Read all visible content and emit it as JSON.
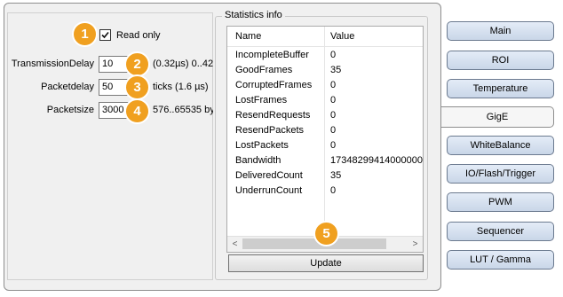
{
  "left": {
    "read_only_label": "Read only",
    "read_only_checked": true,
    "fields": [
      {
        "label": "TransmissionDelay",
        "value": "10",
        "info": "(0.32µs) 0..42"
      },
      {
        "label": "Packetdelay",
        "value": "50",
        "info": "ticks (1.6 µs)"
      },
      {
        "label": "Packetsize",
        "value": "3000",
        "info": "576..65535 by"
      }
    ]
  },
  "stats": {
    "title": "Statistics info",
    "headers": {
      "name": "Name",
      "value": "Value"
    },
    "rows": [
      {
        "name": "IncompleteBuffer",
        "value": "0"
      },
      {
        "name": "GoodFrames",
        "value": "35"
      },
      {
        "name": "CorruptedFrames",
        "value": "0"
      },
      {
        "name": "LostFrames",
        "value": "0"
      },
      {
        "name": "ResendRequests",
        "value": "0"
      },
      {
        "name": "ResendPackets",
        "value": "0"
      },
      {
        "name": "LostPackets",
        "value": "0"
      },
      {
        "name": "Bandwidth",
        "value": "17348299414000000"
      },
      {
        "name": "DeliveredCount",
        "value": "35"
      },
      {
        "name": "UnderrunCount",
        "value": "0"
      }
    ],
    "update_label": "Update",
    "scroll_left": "<",
    "scroll_right": ">"
  },
  "badges": [
    "1",
    "2",
    "3",
    "4",
    "5"
  ],
  "sidebar": {
    "items": [
      {
        "label": "Main"
      },
      {
        "label": "ROI"
      },
      {
        "label": "Temperature"
      },
      {
        "label": "GigE",
        "active": true
      },
      {
        "label": "WhiteBalance"
      },
      {
        "label": "IO/Flash/Trigger"
      },
      {
        "label": "PWM"
      },
      {
        "label": "Sequencer"
      },
      {
        "label": "LUT / Gamma"
      }
    ]
  },
  "colors": {
    "badge": "#f0a020",
    "button_top": "#e4ecf7",
    "button_bottom": "#c9d6e8"
  }
}
